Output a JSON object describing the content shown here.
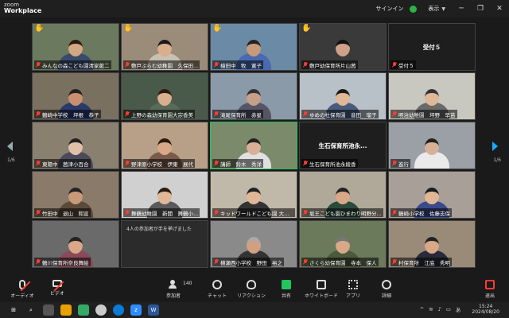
{
  "app": {
    "logo_line1": "zoom",
    "logo_line2": "Workplace",
    "signin": "サインイン",
    "view": "表示"
  },
  "tiles": [
    {
      "name": "みんなの森こども園清家叡二",
      "bg": "#6b7a5e",
      "skin": "#d4a784",
      "shirt": "#3a4a6a",
      "hand": true,
      "hair": "#2a1a10"
    },
    {
      "name": "敷戸ぷらむ幼稚園　久保田...",
      "bg": "#9a8c78",
      "skin": "#d9ae8c",
      "shirt": "#c8c0b0",
      "hand": true,
      "hair": "#1a1a1a"
    },
    {
      "name": "檍田中　牧　寛子",
      "bg": "#6a8aa6",
      "skin": "#c89a7a",
      "shirt": "#4a6ab0",
      "hand": true,
      "hair": "#222"
    },
    {
      "name": "敷戸幼保育所片山茜",
      "bg": "#3a3a3a",
      "skin": "#d0a088",
      "shirt": "#3a3a3a",
      "hand": true,
      "hair": "#111",
      "dark": true
    },
    {
      "name": "受付５",
      "bg": "#1e1e1e",
      "center": "受付５",
      "dark": true
    },
    {
      "name": "鶴崎中学校　坪根　恭子",
      "bg": "#7a7060",
      "skin": "#c89070",
      "shirt": "#2a3a6a",
      "hair": "#222"
    },
    {
      "name": "上野の森幼保育園大宗香美",
      "bg": "#4a5a4a",
      "skin": "#d8b090",
      "shirt": "#5a6a5a",
      "hair": "#2a1a10"
    },
    {
      "name": "滝尾保育所　赤星",
      "bg": "#8a9aa8",
      "skin": "#c8a088",
      "shirt": "#556",
      "hair": "#333"
    },
    {
      "name": "ゆめの杜保育園　音田　瑠子",
      "bg": "#b8c0c8",
      "skin": "#e0b898",
      "shirt": "#4a5a7a",
      "hair": "#1a1a1a"
    },
    {
      "name": "明治幼稚園　坪野　早苗",
      "bg": "#c8c8c0",
      "skin": "#e0b898",
      "shirt": "#6a6a6a",
      "hair": "#333"
    },
    {
      "name": "東陽中　茜津小百合",
      "bg": "#8a8070",
      "skin": "#e0c0a8",
      "shirt": "#4a4a5a",
      "hair": "#222"
    },
    {
      "name": "野津原小学校　伊東　展代",
      "bg": "#b8a088",
      "skin": "#d8a888",
      "shirt": "#7a5a4a",
      "hair": "#2a1a10"
    },
    {
      "name": "講師　鈴木　秀洋",
      "bg": "#7a8a6a",
      "skin": "#d8b098",
      "shirt": "#e0e0e0",
      "hair": "#222",
      "active": true
    },
    {
      "name": "生石保育所池永綾香",
      "bg": "#1e1e1e",
      "center": "生石保育所池永...",
      "dark": true
    },
    {
      "name": "進行",
      "bg": "#9aa0a6",
      "skin": "#d8b098",
      "shirt": "#eaeaea",
      "hair": "#222"
    },
    {
      "name": "竹田中　退山　和宣",
      "bg": "#8a7a6a",
      "skin": "#c89a7a",
      "shirt": "#5a4a3a",
      "hair": "#222"
    },
    {
      "name": "舞鶴幼稚園　新開　舞鶴小...",
      "bg": "#d0d0d0",
      "skin": "#e0b898",
      "shirt": "#5a5a5a",
      "hair": "#2a1a10"
    },
    {
      "name": "キッドワールドこども園 大黒裕子",
      "bg": "#c0b8a8",
      "skin": "#e0b898",
      "shirt": "#333",
      "hair": "#222"
    },
    {
      "name": "坂王こども園ひまわり明野分...",
      "bg": "#b0a898",
      "skin": "#d8a888",
      "shirt": "#2a4a3a",
      "hair": "#222"
    },
    {
      "name": "鶴崎小学校　佐藤志保",
      "bg": "#a8a098",
      "skin": "#e0b898",
      "shirt": "#3a4a8a",
      "hair": "#1a1a1a"
    },
    {
      "name": "鶴川保育所奈良舞絵",
      "bg": "#6a6a6a",
      "skin": "#d8a888",
      "shirt": "#8a4a5a",
      "hair": "#222"
    },
    {
      "name": "",
      "bg": "#2b2b2b",
      "toast": "4人の参加者が手を挙げました",
      "dark": true
    },
    {
      "name": "横瀬西小学校　野田　裕之",
      "bg": "#8a8a8a",
      "skin": "#d0a080",
      "shirt": "#333",
      "hair": "#aaa"
    },
    {
      "name": "さくら幼保育園　寺本　保人",
      "bg": "#6a7a5a",
      "skin": "#d8a888",
      "shirt": "#4a5a3a",
      "hair": "#777"
    },
    {
      "name": "村保育所　江底　秀明",
      "bg": "#9a8a78",
      "skin": "#d8a888",
      "shirt": "#2a2a3a",
      "hair": "#222"
    }
  ],
  "pager": {
    "left": "1/6",
    "right": "1/6"
  },
  "toolbar": {
    "audio": "オーディオ",
    "video": "ビデオ",
    "participants": "参加者",
    "participants_count": "140",
    "chat": "チャット",
    "reactions": "リアクション",
    "share": "共有",
    "whiteboard": "ホワイトボード",
    "apps": "アプリ",
    "more": "詳細",
    "leave": "退出"
  },
  "taskbar": {
    "lang": "あ",
    "time": "15:24",
    "date": "2024/08/20"
  }
}
